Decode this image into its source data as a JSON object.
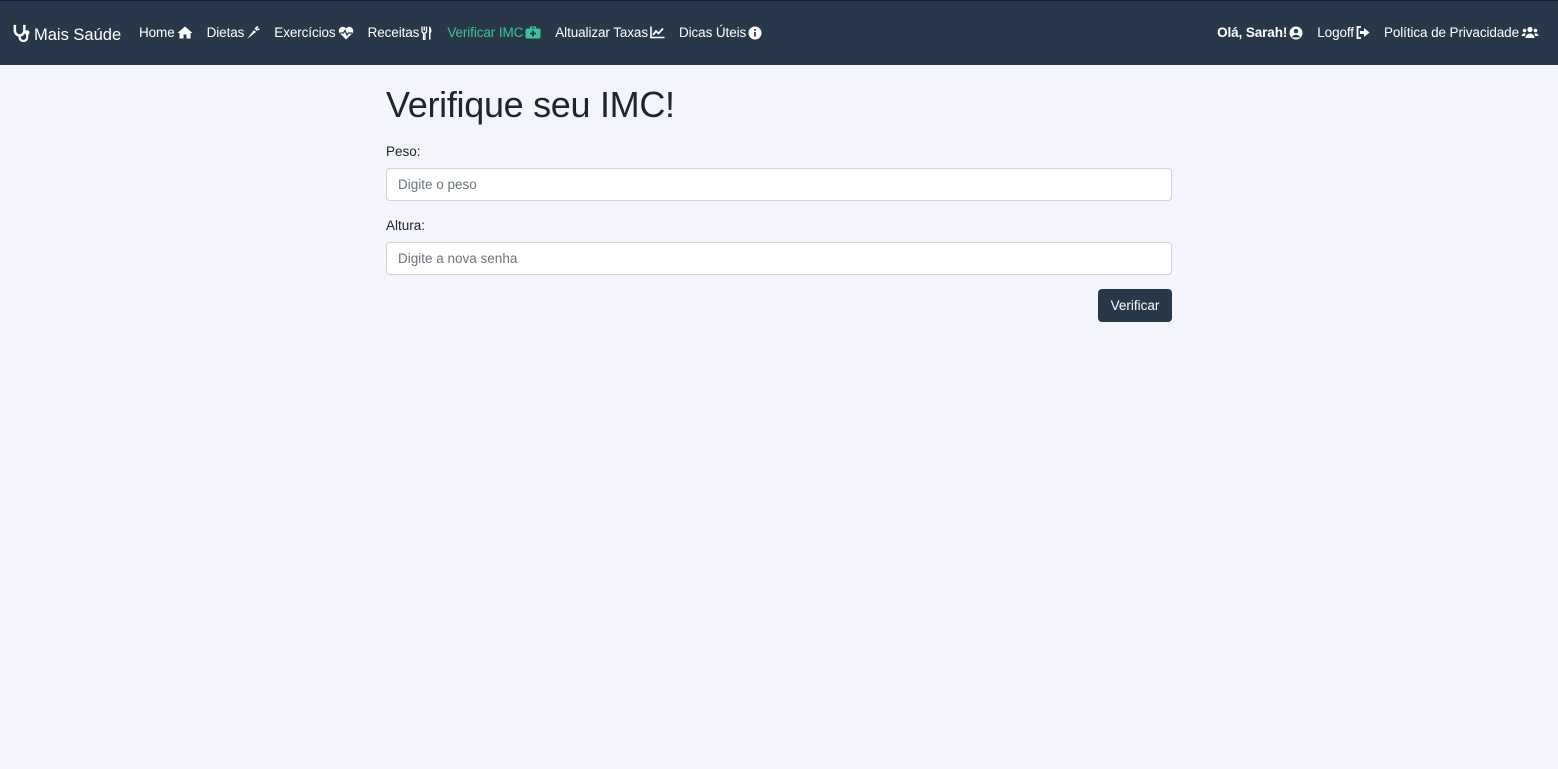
{
  "navbar": {
    "brand": {
      "label": "Mais Saúde",
      "icon": "stethoscope-icon"
    },
    "left_links": [
      {
        "label": "Home",
        "icon": "home-icon"
      },
      {
        "label": "Dietas",
        "icon": "carrot-icon"
      },
      {
        "label": "Exercícios",
        "icon": "heartbeat-icon"
      },
      {
        "label": "Receitas",
        "icon": "utensils-icon"
      },
      {
        "label": "Verificar IMC",
        "icon": "medkit-icon",
        "active": true
      },
      {
        "label": "Altualizar Taxas",
        "icon": "chart-line-icon"
      },
      {
        "label": "Dicas Úteis",
        "icon": "info-circle-icon"
      }
    ],
    "right_links": [
      {
        "label": "Olá, Sarah!",
        "icon": "user-circle-icon"
      },
      {
        "label": "Logoff",
        "icon": "sign-out-icon"
      },
      {
        "label": "Política de Privacidade",
        "icon": "users-icon"
      }
    ]
  },
  "main": {
    "title": "Verifique seu IMC!",
    "peso": {
      "label": "Peso:",
      "placeholder": "Digite o peso",
      "value": ""
    },
    "altura": {
      "label": "Altura:",
      "placeholder": "Digite a nova senha",
      "value": ""
    },
    "submit_label": "Verificar"
  },
  "colors": {
    "navbar_bg": "#28384a",
    "page_bg": "#f4f5fc",
    "active_link": "#3cc39a",
    "button_bg": "#28384a"
  }
}
